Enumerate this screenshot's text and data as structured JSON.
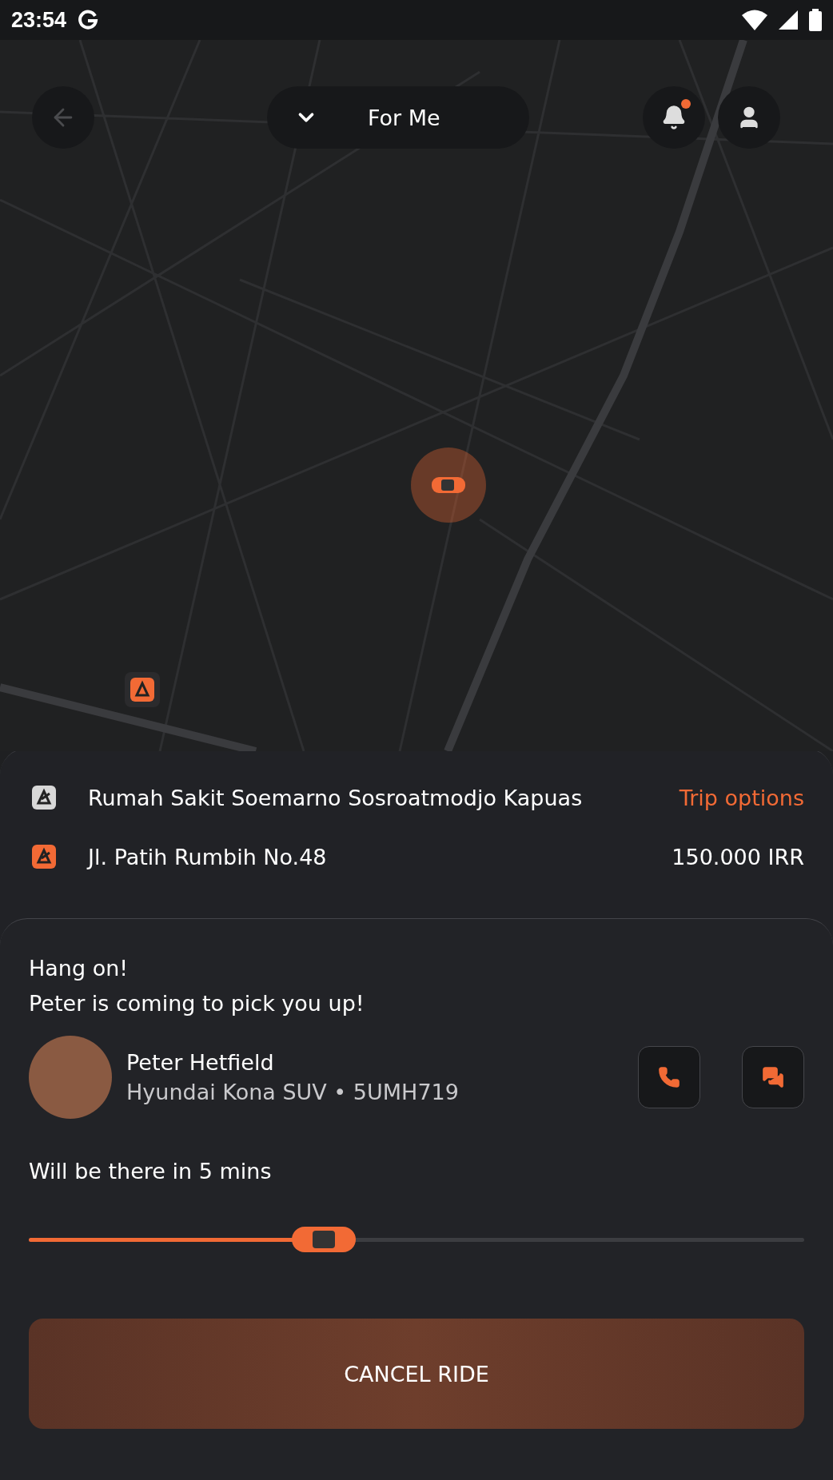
{
  "status_bar": {
    "time": "23:54"
  },
  "header": {
    "selector": "For Me",
    "notification_unread": true
  },
  "trip": {
    "pickup": "Rumah Sakit Soemarno Sosroatmodjo Kapuas",
    "options_link": "Trip options",
    "destination": "Jl. Patih Rumbih No.48",
    "price": "150.000 IRR"
  },
  "driver_panel": {
    "title_lines": [
      "Hang on!",
      "Peter is coming to pick you up!"
    ],
    "driver_name": "Peter Hetfield",
    "vehicle": "Hyundai Kona SUV • 5UMH719",
    "eta": "Will be there in 5 mins",
    "progress": {
      "level": 0.38
    },
    "cancel_button": "CANCEL RIDE"
  }
}
